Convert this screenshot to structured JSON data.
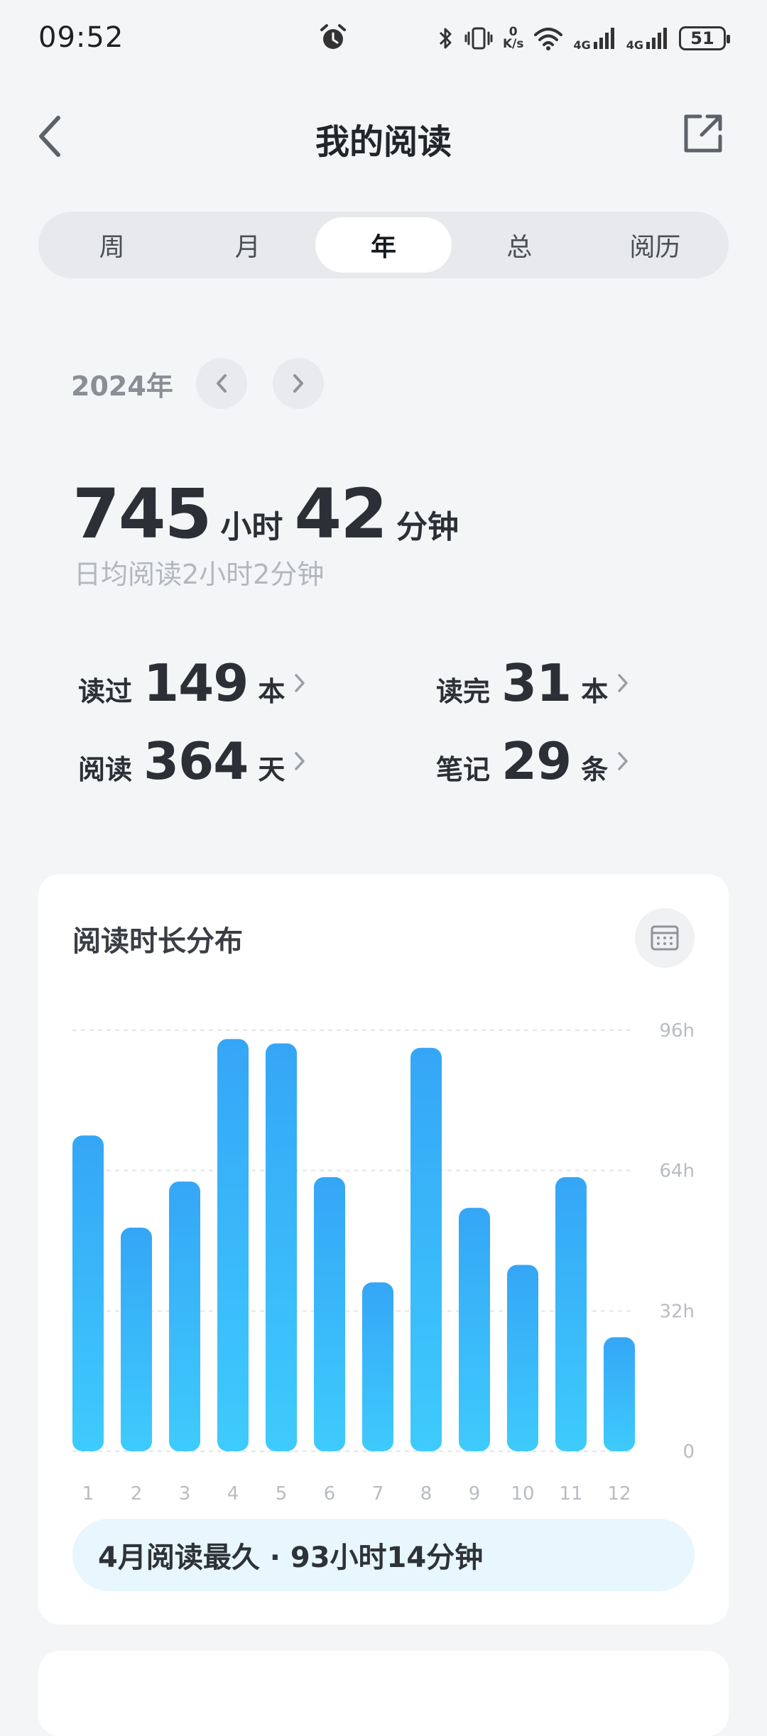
{
  "status": {
    "time": "09:52",
    "speed_top": "0",
    "speed_unit": "K/s",
    "net1": "4G",
    "net2": "4G",
    "battery": "51"
  },
  "header": {
    "title": "我的阅读"
  },
  "tabs": [
    {
      "label": "周",
      "active": false
    },
    {
      "label": "月",
      "active": false
    },
    {
      "label": "年",
      "active": true
    },
    {
      "label": "总",
      "active": false
    },
    {
      "label": "阅历",
      "active": false
    }
  ],
  "year": {
    "label": "2024年"
  },
  "summary": {
    "hours": "745",
    "hours_unit": "小时",
    "minutes": "42",
    "minutes_unit": "分钟",
    "daily_avg": "日均阅读2小时2分钟"
  },
  "stats": {
    "read": {
      "label": "读过",
      "value": "149",
      "unit": "本"
    },
    "finished": {
      "label": "读完",
      "value": "31",
      "unit": "本"
    },
    "days": {
      "label": "阅读",
      "value": "364",
      "unit": "天"
    },
    "notes": {
      "label": "笔记",
      "value": "29",
      "unit": "条"
    }
  },
  "card": {
    "title": "阅读时长分布",
    "highlight": "4月阅读最久 · 93小时14分钟"
  },
  "chart_data": {
    "type": "bar",
    "categories": [
      "1",
      "2",
      "3",
      "4",
      "5",
      "6",
      "7",
      "8",
      "9",
      "10",
      "11",
      "12"
    ],
    "values": [
      72,
      51,
      61.5,
      94,
      93,
      62.5,
      38.5,
      92,
      55.5,
      42.5,
      62.5,
      26
    ],
    "ylim": [
      0,
      96
    ],
    "yticks": [
      {
        "value": 96,
        "label": "96h"
      },
      {
        "value": 64,
        "label": "64h"
      },
      {
        "value": 32,
        "label": "32h"
      },
      {
        "value": 0,
        "label": "0"
      }
    ],
    "grid": true,
    "colors": {
      "bar_top": "#35a6f6",
      "bar_bottom": "#3ecbfd",
      "grid": "#e3e5e8",
      "tick": "#b8bcc2"
    }
  }
}
